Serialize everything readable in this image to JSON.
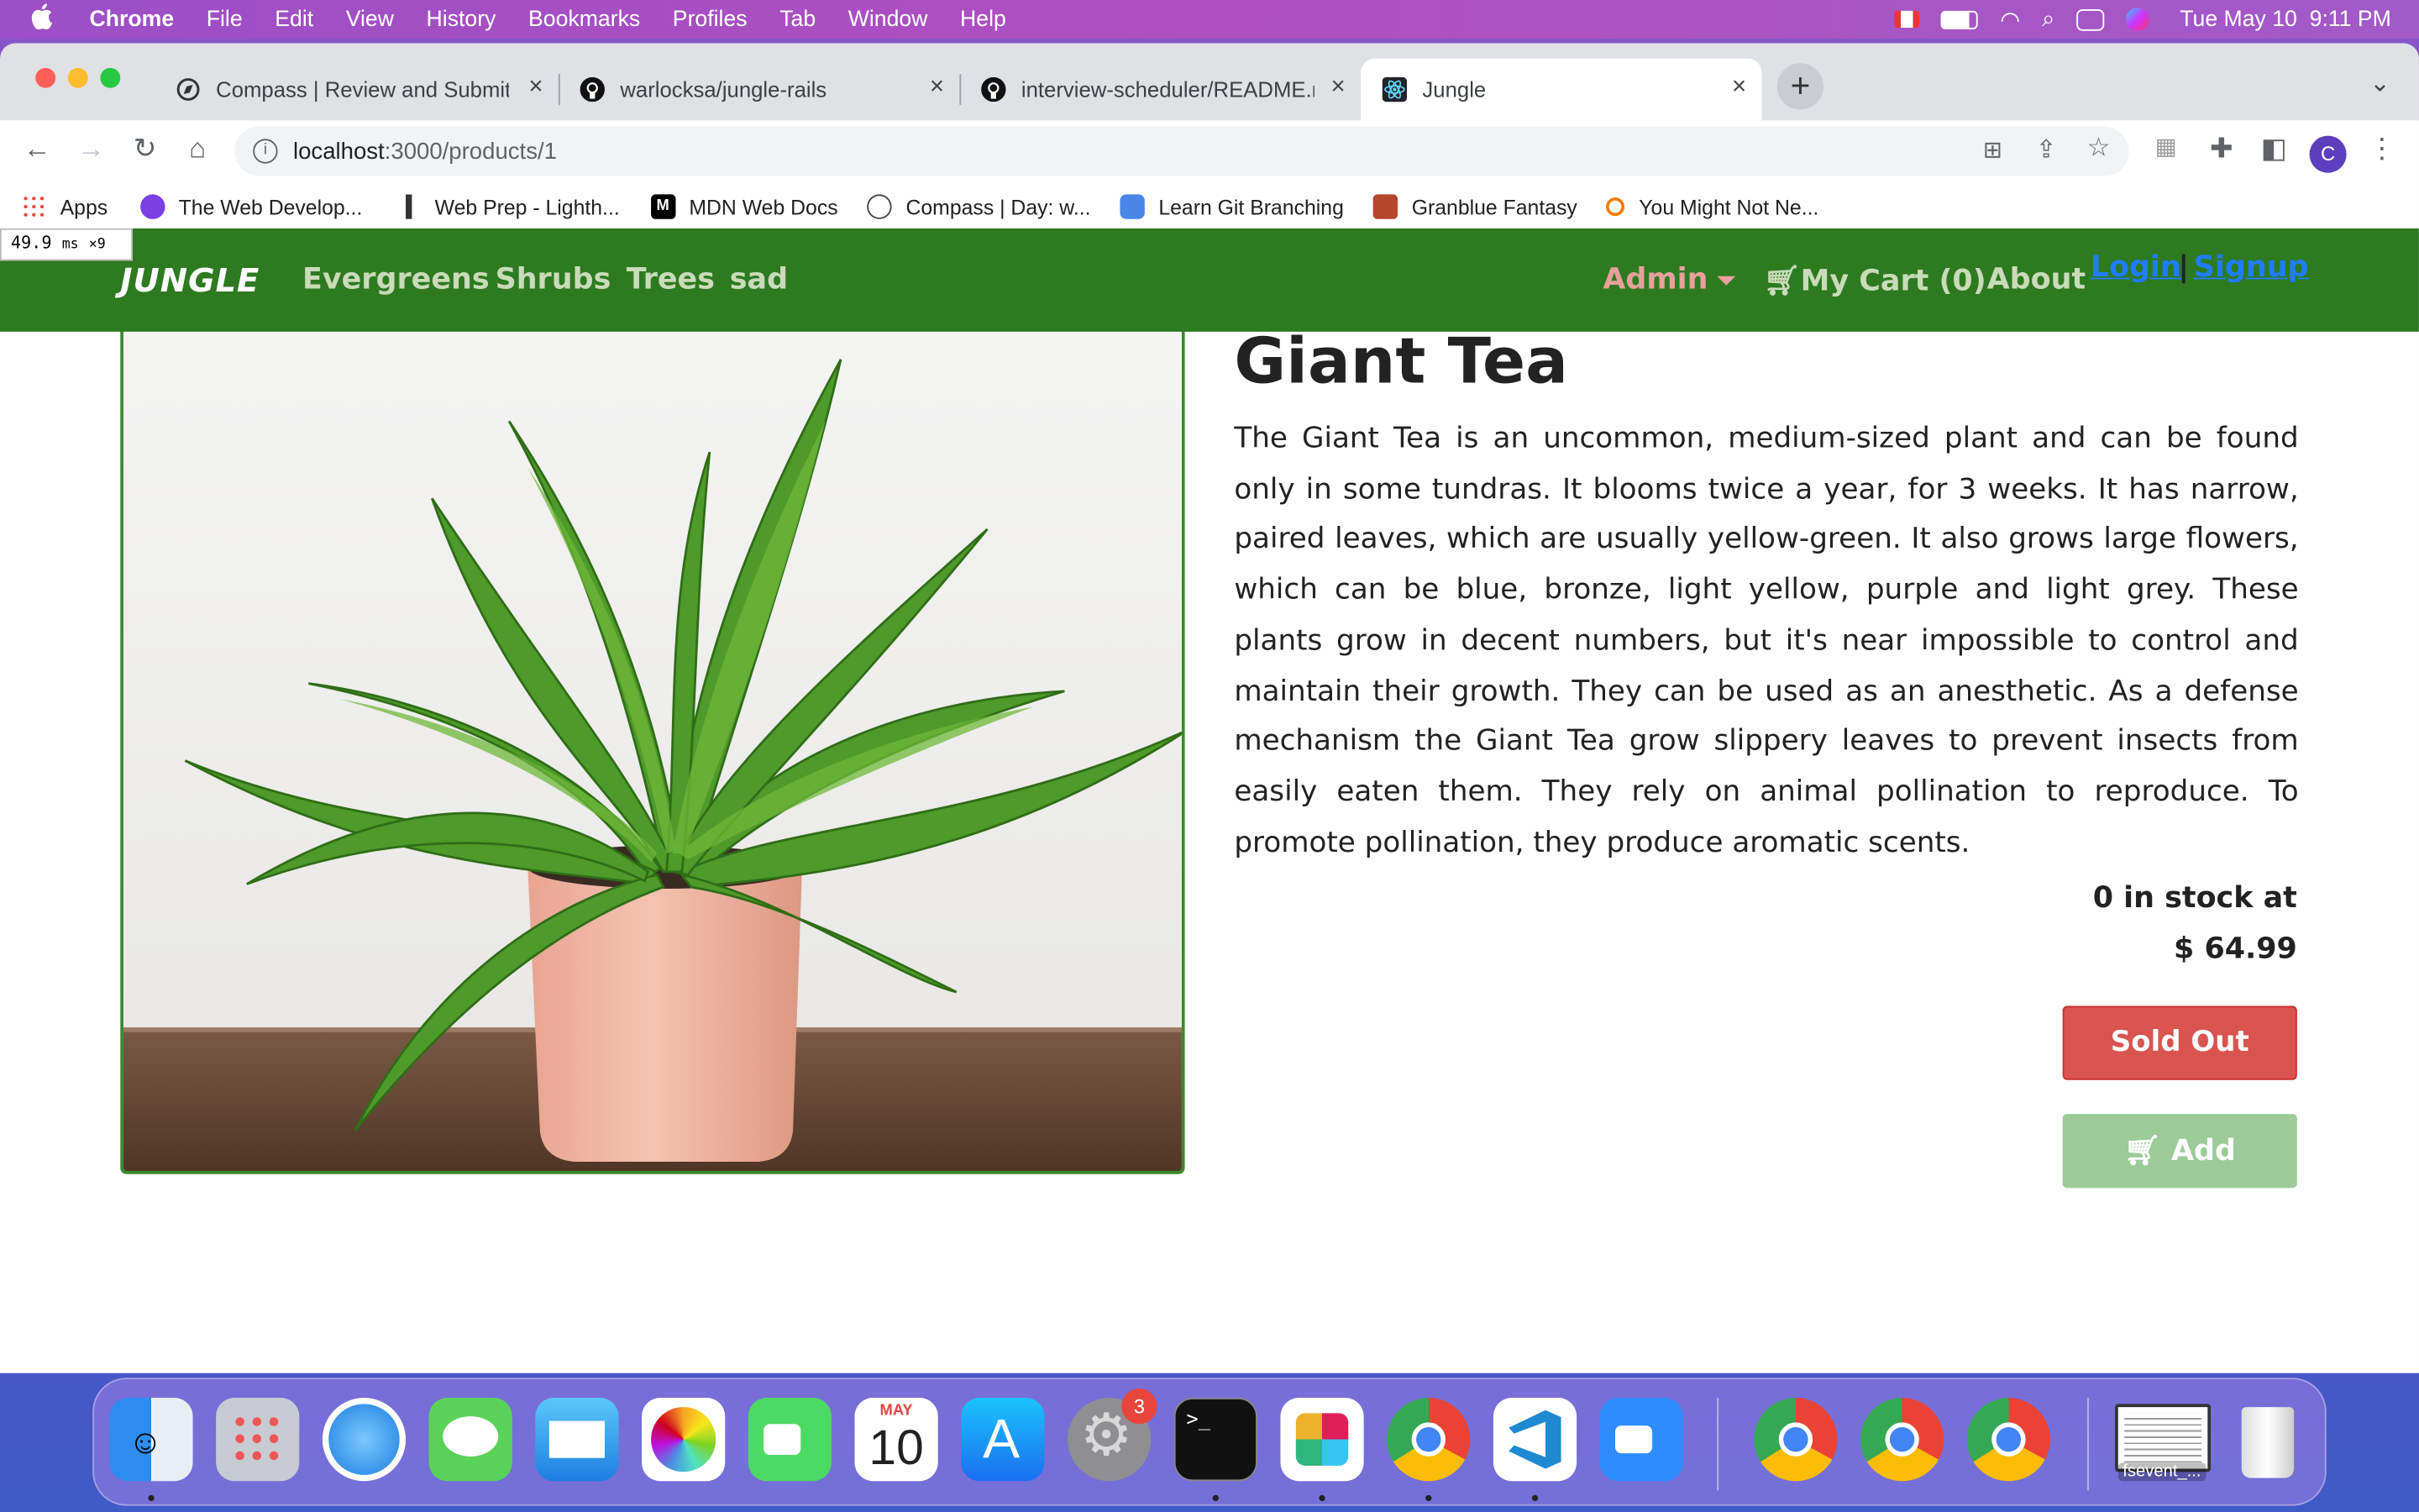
{
  "menubar": {
    "app": "Chrome",
    "items": [
      "File",
      "Edit",
      "View",
      "History",
      "Bookmarks",
      "Profiles",
      "Tab",
      "Window",
      "Help"
    ],
    "datetime": "Tue May 10  9:11 PM"
  },
  "tabs": [
    {
      "title": "Compass | Review and Submit",
      "icon": "compass-icon"
    },
    {
      "title": "warlocksa/jungle-rails",
      "icon": "github-icon"
    },
    {
      "title": "interview-scheduler/README.m",
      "icon": "github-icon"
    },
    {
      "title": "Jungle",
      "icon": "react-icon",
      "active": true
    }
  ],
  "omnibox": {
    "host": "localhost",
    "path": ":3000/products/1"
  },
  "bookmarks": [
    {
      "label": "Apps",
      "color": "#e8453c"
    },
    {
      "label": "The Web Develop...",
      "color": "#7b3fe4"
    },
    {
      "label": "Web Prep - Lighth...",
      "color": "#333333"
    },
    {
      "label": "MDN Web Docs",
      "color": "#000000"
    },
    {
      "label": "Compass | Day: w...",
      "color": "#444444"
    },
    {
      "label": "Learn Git Branching",
      "color": "#4a86e8"
    },
    {
      "label": "Granblue Fantasy",
      "color": "#b5452c"
    },
    {
      "label": "You Might Not Ne...",
      "color": "#f57c00"
    }
  ],
  "perf": {
    "value": "49.9",
    "unit": "ms",
    "count": "×9"
  },
  "nav": {
    "logo": "JUNGLE",
    "categories": [
      "Evergreens",
      "Shrubs",
      "Trees",
      "sad"
    ],
    "admin": "Admin",
    "cart": "My Cart (0)",
    "about": "About",
    "login": "Login",
    "separator": "|",
    "signup": "Signup"
  },
  "product": {
    "name": "Giant Tea",
    "description": "The Giant Tea is an uncommon, medium-sized plant and can be found only in some tundras. It blooms twice a year, for 3 weeks. It has narrow, paired leaves, which are usually yellow-green. It also grows large flowers, which can be blue, bronze, light yellow, purple and light grey. These plants grow in decent numbers, but it's near impossible to control and maintain their growth. They can be used as an anesthetic. As a defense mechanism the Giant Tea grow slippery leaves to prevent insects from easily eaten them. They rely on animal pollination to reproduce. To promote pollination, they produce aromatic scents.",
    "stock_line": "0 in stock at",
    "price": "$ 64.99",
    "sold_out_label": "Sold Out",
    "add_label": "Add"
  },
  "dock": {
    "apps": [
      "Finder",
      "Launchpad",
      "Safari",
      "Messages",
      "Mail",
      "Photos",
      "FaceTime",
      "Calendar",
      "App Store",
      "System Preferences",
      "Terminal",
      "Slack",
      "Google Chrome",
      "Visual Studio Code",
      "Zoom",
      "Google Chrome",
      "Google Chrome",
      "Google Chrome"
    ],
    "calendar_month": "MAY",
    "calendar_day": "10",
    "badge": "3",
    "file_label": "fsevent_..."
  }
}
